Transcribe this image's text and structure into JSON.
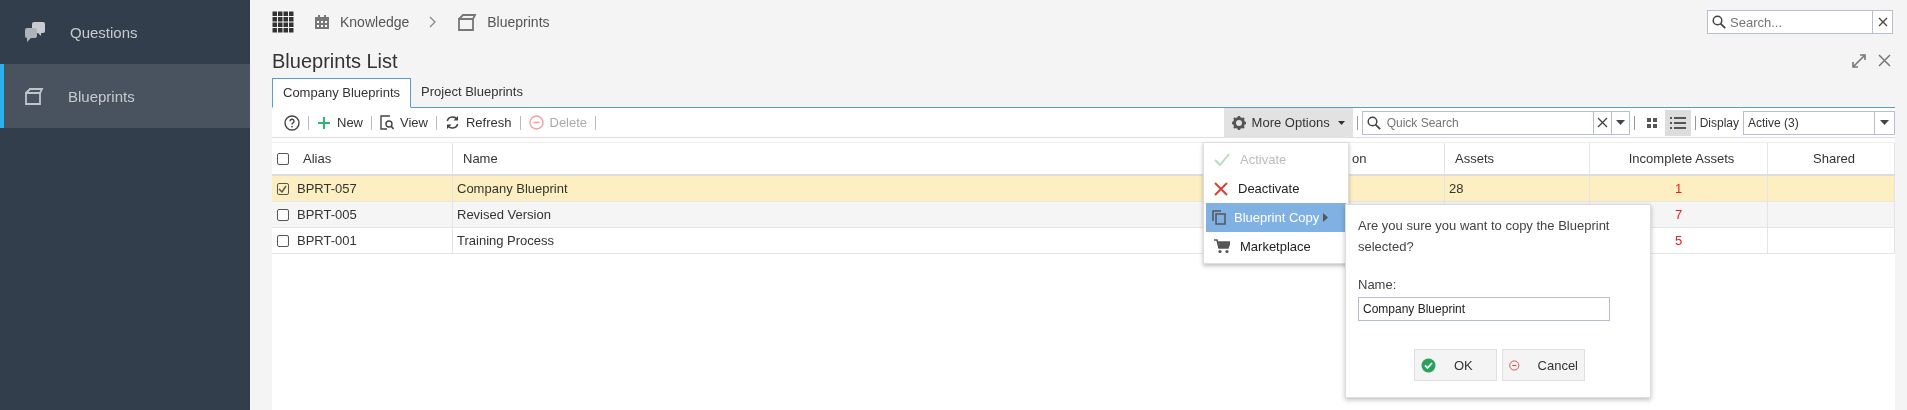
{
  "sidebar": {
    "items": [
      {
        "label": "Questions",
        "kind": "questions",
        "selected": false
      },
      {
        "label": "Blueprints",
        "kind": "blueprints",
        "selected": true
      }
    ]
  },
  "breadcrumb": [
    {
      "label": "Knowledge",
      "kind": "calendar"
    },
    {
      "label": "Blueprints",
      "kind": "blueprints"
    }
  ],
  "global_search": {
    "placeholder": "Search..."
  },
  "page_title": "Blueprints List",
  "tabs": [
    {
      "label": "Company Blueprints",
      "selected": true
    },
    {
      "label": "Project Blueprints",
      "selected": false
    }
  ],
  "toolbar": {
    "buttons": [
      {
        "kind": "help"
      },
      {
        "kind": "new",
        "label": "New",
        "disabled": false
      },
      {
        "kind": "view",
        "label": "View",
        "disabled": false
      },
      {
        "kind": "refresh",
        "label": "Refresh",
        "disabled": false
      },
      {
        "kind": "delete",
        "label": "Delete",
        "disabled": true
      }
    ],
    "more_options": "More Options",
    "quick_search": {
      "placeholder": "Quick Search"
    },
    "views": [
      {
        "kind": "grid",
        "selected": false
      },
      {
        "kind": "list",
        "selected": true
      }
    ],
    "display_label": "Display",
    "display_value": "Active (3)"
  },
  "table": {
    "select_all_checked": false,
    "columns": [
      {
        "label": "Alias"
      },
      {
        "label": "Name"
      },
      {
        "label": "on"
      },
      {
        "label": "Assets"
      },
      {
        "label": "Incomplete Assets"
      },
      {
        "label": "Shared"
      }
    ],
    "rows": [
      {
        "checked": true,
        "selected": true,
        "cells": [
          "BPRT-057",
          "Company Blueprint",
          null,
          "28",
          "1",
          null
        ]
      },
      {
        "checked": false,
        "selected": false,
        "cells": [
          "BPRT-005",
          "Revised Version",
          null,
          null,
          "7",
          null
        ]
      },
      {
        "checked": false,
        "selected": false,
        "cells": [
          "BPRT-001",
          "Training Process",
          null,
          null,
          "5",
          null
        ]
      }
    ]
  },
  "menu": {
    "items": [
      {
        "kind": "activate",
        "label": "Activate",
        "disabled": true,
        "selected": false
      },
      {
        "kind": "deactivate",
        "label": "Deactivate",
        "disabled": false,
        "selected": false
      },
      {
        "kind": "copy",
        "label": "Blueprint Copy",
        "disabled": false,
        "selected": true,
        "submenu": true
      },
      {
        "kind": "cart",
        "label": "Marketplace",
        "disabled": false,
        "selected": false
      }
    ]
  },
  "copy_dialog": {
    "message": "Are you sure you want to copy the Blueprint selected?",
    "name_label": "Name:",
    "name_value": "Company Blueprint",
    "buttons": [
      {
        "kind": "ok",
        "label": "OK"
      },
      {
        "kind": "cancel",
        "label": "Cancel"
      }
    ]
  }
}
